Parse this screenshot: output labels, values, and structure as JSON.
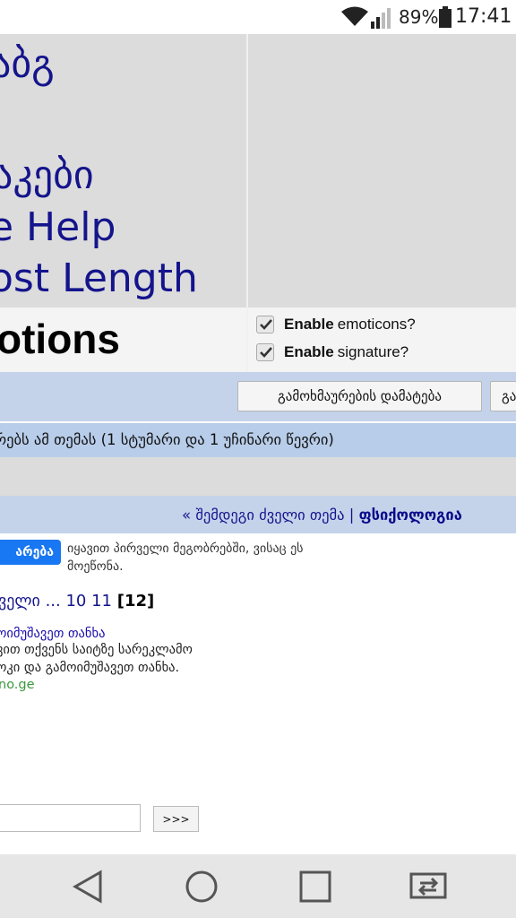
{
  "status_bar": {
    "battery_percent": "89%",
    "time": "17:41",
    "icons": [
      "wifi-icon",
      "signal-icon",
      "battery-icon"
    ]
  },
  "sidebar_links": {
    "link1": "აბგ",
    "link2": "აკები",
    "link3": "e Help",
    "link4": "ost Length"
  },
  "options": {
    "title": "otions",
    "emoticons_bold": "Enable",
    "emoticons_rest": "emoticons?",
    "emoticons_checked": true,
    "signature_bold": "Enable",
    "signature_rest": "signature?",
    "signature_checked": true
  },
  "toolbar": {
    "add_reply": "გამოხმაურების დამატება",
    "next_partial": "გა"
  },
  "viewers_text": "რებს ამ თემას (1 სტუმარი და 1 უჩინარი წევრი)",
  "thread_nav": {
    "prefix": "« შემდეგი ძველი თემა | ",
    "forum": "ფსიქოლოგია"
  },
  "like": {
    "button": "არება",
    "text": "იყავით პირველი მეგობრებში, ვისაც ეს მოეწონა."
  },
  "pagination": {
    "prefix": "ველი ... 10 11 ",
    "current": "[12]"
  },
  "ad": {
    "title": "ოიმუშავეთ თანხა",
    "line1": "ვით თქვენს საიტზე სარეკლამო",
    "line2": "ოკი და გამოიმუშავეთ თანხა.",
    "url": "no.ge"
  },
  "jump": {
    "button": ">>>"
  },
  "nav_bar": {
    "icons": [
      "back-icon",
      "home-icon",
      "recents-icon",
      "switch-app-icon"
    ]
  },
  "colors": {
    "link_blue": "#14148c",
    "strip_blue": "#c4d3ea",
    "grey": "#dcdcdc",
    "fb_blue": "#1877f2"
  }
}
